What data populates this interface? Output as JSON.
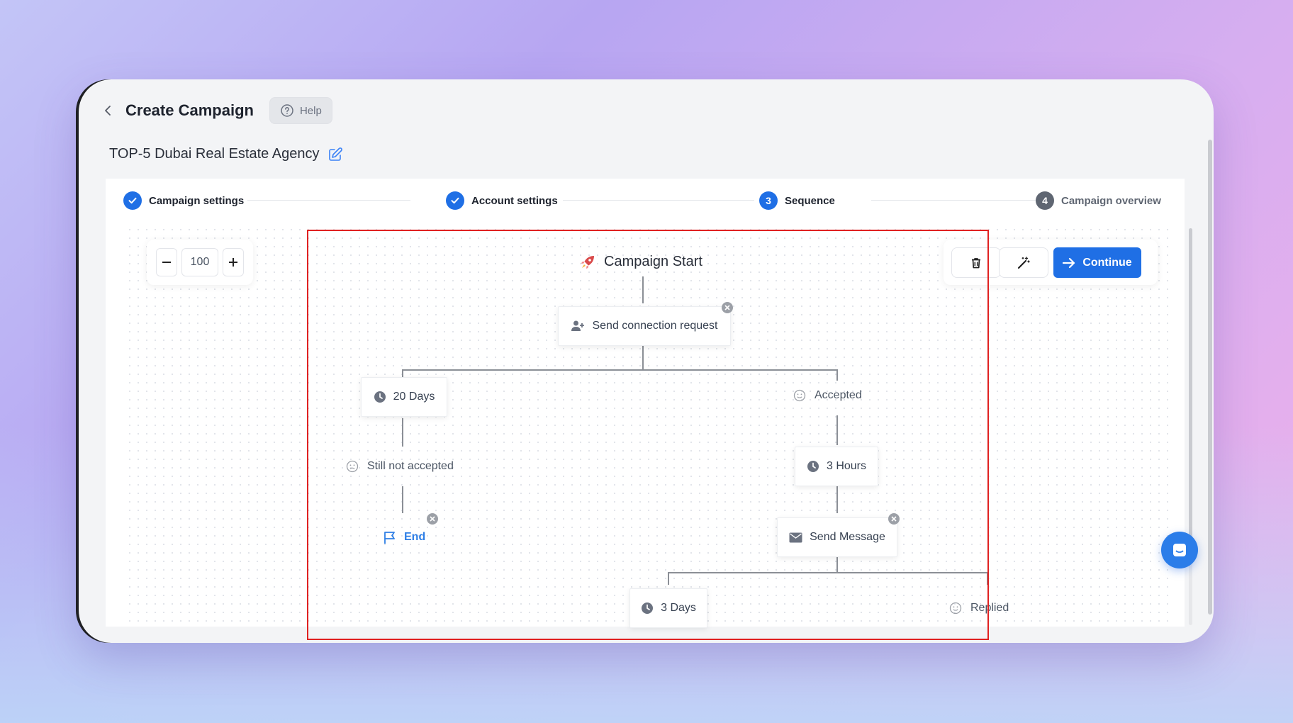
{
  "header": {
    "title": "Create Campaign",
    "help_label": "Help"
  },
  "campaign": {
    "name": "TOP-5 Dubai Real Estate Agency"
  },
  "stepper": {
    "steps": [
      {
        "label": "Campaign settings",
        "status": "done"
      },
      {
        "label": "Account settings",
        "status": "done"
      },
      {
        "label": "Sequence",
        "number": "3",
        "status": "active"
      },
      {
        "label": "Campaign overview",
        "number": "4",
        "status": "pending"
      }
    ]
  },
  "zoom": {
    "value": "100"
  },
  "toolbar": {
    "continue_label": "Continue"
  },
  "flow": {
    "start_label": "Campaign Start",
    "send_connection_label": "Send connection request",
    "wait_20_days_label": "20 Days",
    "accepted_label": "Accepted",
    "still_not_accepted_label": "Still not accepted",
    "wait_3_hours_label": "3 Hours",
    "end_label": "End",
    "send_message_label": "Send Message",
    "wait_3_days_label": "3 Days",
    "replied_label": "Replied"
  },
  "colors": {
    "primary": "#1f6fe5",
    "step_pending": "#5f6672",
    "end_link": "#2f7fe6",
    "highlight": "#e02121"
  }
}
